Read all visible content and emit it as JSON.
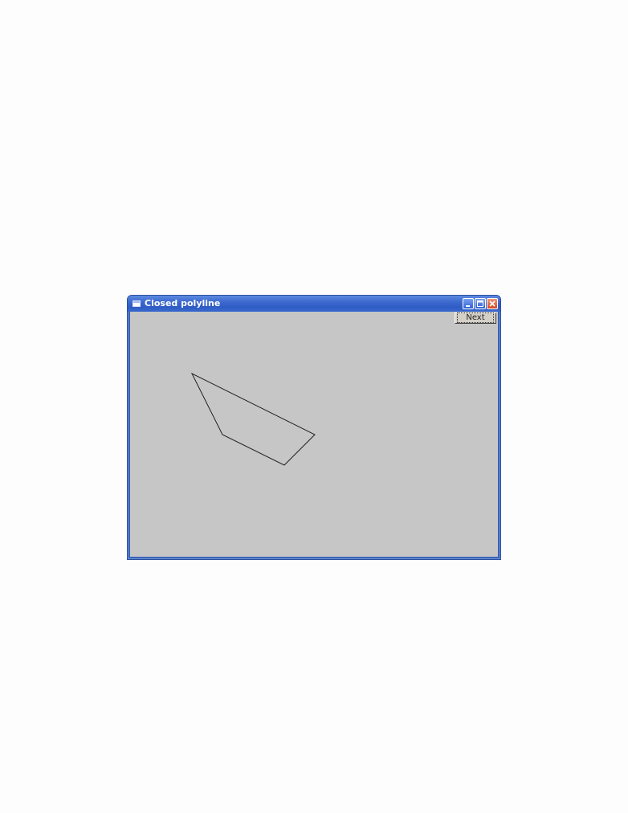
{
  "window": {
    "title": "Closed polyline",
    "controls": {
      "minimize_icon": "minimize-icon",
      "maximize_icon": "maximize-icon",
      "close_icon": "close-icon"
    }
  },
  "toolbar": {
    "next_label": "Next"
  },
  "colors": {
    "titlebar": "#3a63b8",
    "client_background": "#c6c6c6",
    "polyline_stroke": "#222222"
  }
}
